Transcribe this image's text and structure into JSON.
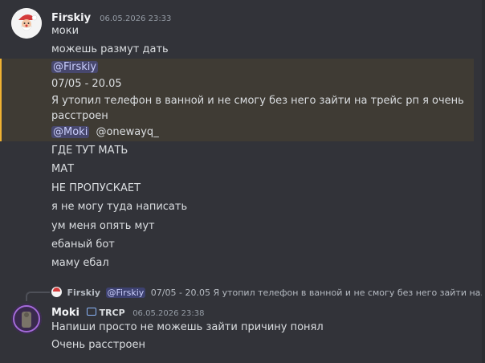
{
  "message1": {
    "author": "Firskiy",
    "timestamp": "06.05.2026 23:33",
    "lines": [
      "моки",
      "можешь размут дать"
    ],
    "quote": {
      "mention": "@Firskiy",
      "line1": "07/05 - 20.05",
      "line2": "Я утопил телефон в ванной и не смогу без него зайти на трейс рп я очень",
      "line3": "расстроен",
      "mention2": "@Moki",
      "mention3": "@onewayq_"
    },
    "more_lines": [
      "ГДЕ ТУТ МАТЬ",
      "МАТ",
      "НЕ ПРОПУСКАЕТ",
      "я не могу туда написать",
      "ум меня опять мут",
      "ебаный бот",
      "маму ебал"
    ]
  },
  "message2": {
    "reply": {
      "author": "Firskiy",
      "mention": "@Firskiy",
      "text": "07/05 - 20.05 Я утопил телефон в ванной и не смогу без него зайти на..."
    },
    "author": "Moki",
    "tag": "TRCP",
    "timestamp": "06.05.2026 23:38",
    "lines": [
      "Напиши просто не можешь зайти причину понял",
      "Очень расстроен"
    ]
  },
  "colors": {
    "background": "#323339",
    "highlight": "#3f3b34",
    "highlight_border": "#f0b232",
    "mention": "#c9cdfb"
  }
}
